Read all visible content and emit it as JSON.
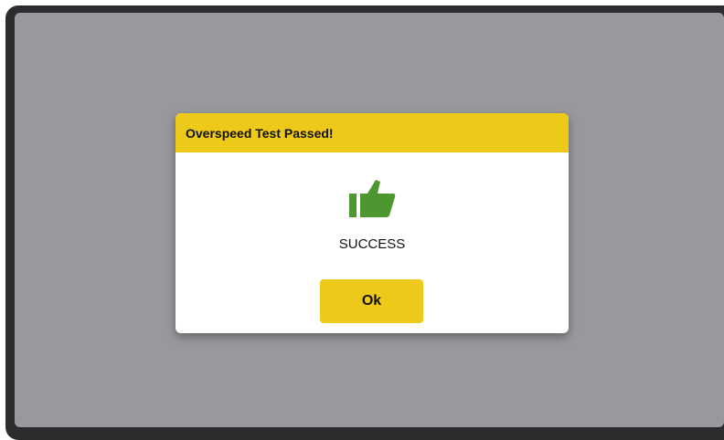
{
  "dialog": {
    "title": "Overspeed Test Passed!",
    "icon": "thumbs-up-icon",
    "status": "SUCCESS",
    "ok_label": "Ok"
  },
  "colors": {
    "accent": "#edc91a",
    "icon_green": "#4e962f",
    "overlay": "#98999d",
    "frame": "#2b2c2e"
  }
}
